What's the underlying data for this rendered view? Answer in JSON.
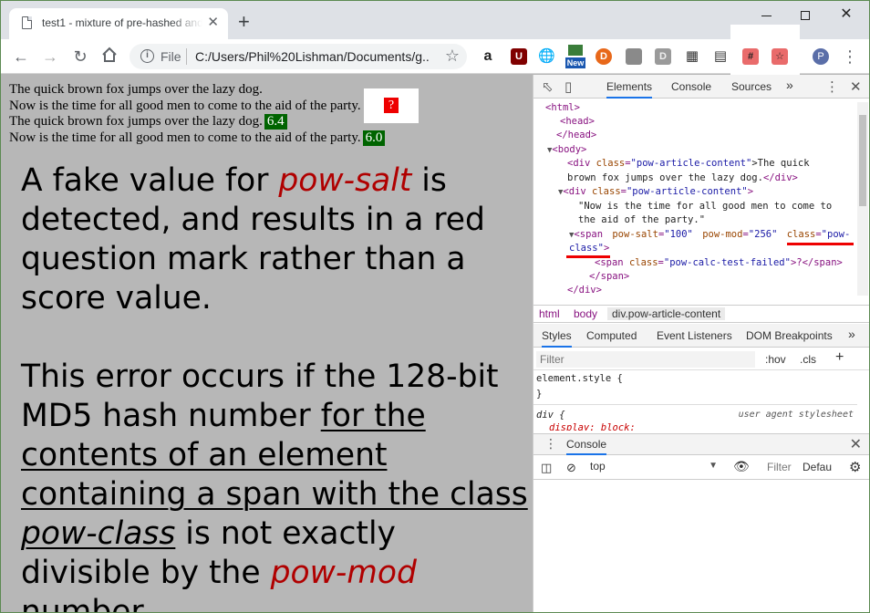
{
  "browser": {
    "tab_title": "test1 - mixture of pre-hashed and",
    "tab_close": "✕",
    "new_tab": "+",
    "file_label": "File",
    "url": "C:/Users/Phil%20Lishman/Documents/g...",
    "ext_new_badge": "New",
    "ext_pow_hash": "#",
    "ext_pow_star": "☆",
    "profile_initial": "P"
  },
  "page": {
    "lines": [
      {
        "text": "The quick brown fox jumps over the lazy dog.",
        "score": ""
      },
      {
        "text": "Now is the time for all good men to come to the aid of the party.",
        "score": "?"
      },
      {
        "text": "The quick brown fox jumps over the lazy dog.",
        "score": "6.4"
      },
      {
        "text": "Now is the time for all good men to come to the aid of the party.",
        "score": "6.0"
      }
    ]
  },
  "annotation": {
    "p1_a": "A fake value for ",
    "p1_term": "pow-salt",
    "p1_b": " is detected, and results in a red question mark rather than a score value.",
    "p2_a": "This error occurs if the 128-bit MD5 hash number ",
    "p2_ul1": "for the contents of an element containing a span with the class",
    "p2_space": " ",
    "p2_ul_term": "pow-class",
    "p2_b": " is not exactly divisible by the ",
    "p2_term": "pow-mod",
    "p2_c": " number."
  },
  "colors": {
    "score_green": "#006400",
    "error_red": "#ee0000",
    "annotation_red": "#b00000",
    "devtools_accent": "#1a73e8"
  },
  "devtools": {
    "tabs": [
      "Elements",
      "Console",
      "Sources",
      "»"
    ],
    "dom": {
      "html_open": "<html>",
      "head_open": "<head>",
      "head_close": "</head>",
      "body_open": "<body>",
      "div1_tag": "<div ",
      "div1_attr": "class",
      "div1_val": "\"pow-article-content\"",
      "div1_text": ">The quick",
      "div1_text2": "brown fox jumps over the lazy dog.",
      "div1_close": "</div>",
      "div2_tag": "<div ",
      "div2_attr": "class",
      "div2_val": "\"pow-article-content\"",
      "div2_end": ">",
      "div2_text1": "\"Now is the time for all good men to come to",
      "div2_text2": "the aid of the party.\"",
      "span_tag": "<span ",
      "salt_attr": "pow-salt",
      "salt_val": "\"100\"",
      "mod_attr": "pow-mod",
      "mod_val": "\"256\"",
      "class_attr": "class",
      "class_val1": "\"pow-",
      "class_val2": "class\"",
      "span_end": ">",
      "inner_span_tag": "<span ",
      "inner_attr": "class",
      "inner_val": "\"pow-calc-test-failed\"",
      "inner_text": ">?</span>",
      "span_close": "</span>",
      "div_close": "</div>"
    },
    "breadcrumbs": [
      "html",
      "body",
      "div.pow-article-content"
    ],
    "style_tabs": [
      "Styles",
      "Computed",
      "Event Listeners",
      "DOM Breakpoints",
      "»"
    ],
    "filter_placeholder": "Filter",
    "hov": ":hov",
    "cls": ".cls",
    "plus": "+",
    "element_style": "element.style {",
    "element_style_close": "}",
    "div_rule": "div {",
    "ua_label": "user agent stylesheet",
    "display_prop": "display: block;",
    "drawer_tab": "Console",
    "console_context": "top",
    "console_filter": "Filter",
    "console_levels": "Defau"
  }
}
